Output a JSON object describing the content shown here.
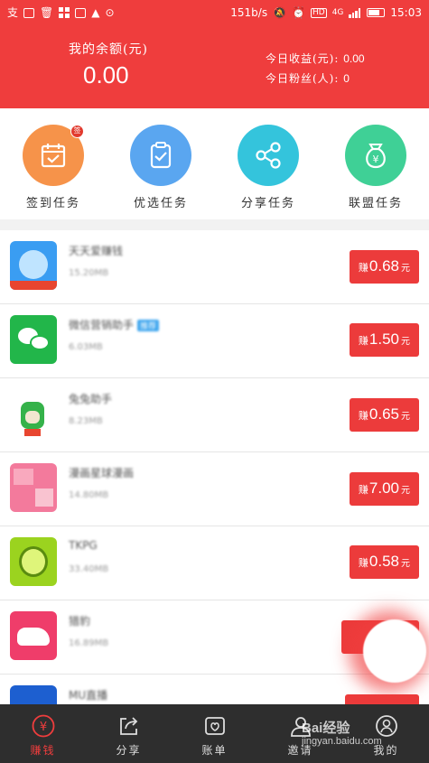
{
  "status_bar": {
    "left_icons": [
      "sim-icon",
      "message-icon",
      "trash-icon",
      "grid-icon",
      "image-icon",
      "warning-icon",
      "more-icon"
    ],
    "speed": "151b/s",
    "network": "4G",
    "time": "15:03"
  },
  "header": {
    "balance_label": "我的余额(元)",
    "balance_value": "0.00",
    "today_income_label": "今日收益(元):",
    "today_income_value": "0.00",
    "today_fans_label": "今日粉丝(人):",
    "today_fans_value": "0"
  },
  "tasks": [
    {
      "label": "签到任务",
      "icon": "calendar-check-icon",
      "color": "#f6934a",
      "badge": "签"
    },
    {
      "label": "优选任务",
      "icon": "clipboard-check-icon",
      "color": "#5aa6f0",
      "badge": ""
    },
    {
      "label": "分享任务",
      "icon": "share-icon",
      "color": "#34c4dc",
      "badge": ""
    },
    {
      "label": "联盟任务",
      "icon": "money-bag-icon",
      "color": "#3fd096",
      "badge": ""
    }
  ],
  "apps": [
    {
      "name": "天天爱赚钱",
      "size": "15.20MB",
      "tag": "",
      "earn_prefix": "赚",
      "amount": "0.68",
      "unit": "元",
      "icon_color": "#3a9df2"
    },
    {
      "name": "微信营销助手",
      "size": "6.03MB",
      "tag": "推荐",
      "earn_prefix": "赚",
      "amount": "1.50",
      "unit": "元",
      "icon_color": "#22b64a"
    },
    {
      "name": "兔兔助手",
      "size": "8.23MB",
      "tag": "",
      "earn_prefix": "赚",
      "amount": "0.65",
      "unit": "元",
      "icon_color": "#ffffff"
    },
    {
      "name": "漫画星球漫画",
      "size": "14.80MB",
      "tag": "",
      "earn_prefix": "赚",
      "amount": "7.00",
      "unit": "元",
      "icon_color": "#f37a9c"
    },
    {
      "name": "TKPG",
      "size": "33.40MB",
      "tag": "",
      "earn_prefix": "赚",
      "amount": "0.58",
      "unit": "元",
      "icon_color": "#9bd31f"
    },
    {
      "name": "猎豹",
      "size": "16.89MB",
      "tag": "",
      "earn_prefix": "",
      "amount": "",
      "unit": "",
      "icon_color": "#ef3d6a"
    },
    {
      "name": "MU直播",
      "size": "",
      "tag": "",
      "earn_prefix": "",
      "amount": "",
      "unit": "",
      "icon_color": "#1d5fd0"
    }
  ],
  "tabs": [
    {
      "label": "赚钱",
      "icon": "yen-coin-icon",
      "active": true
    },
    {
      "label": "分享",
      "icon": "share-arrow-icon",
      "active": false
    },
    {
      "label": "账单",
      "icon": "bill-icon",
      "active": false
    },
    {
      "label": "邀请",
      "icon": "user-icon",
      "active": false
    },
    {
      "label": "我的",
      "icon": "profile-icon",
      "active": false
    }
  ],
  "watermark": {
    "brand": "Bai经验",
    "url": "jingyan.baidu.com"
  },
  "colors": {
    "primary": "#ef3d3d",
    "tabbar": "#2e2e2e",
    "separator": "#f2f2f2"
  }
}
